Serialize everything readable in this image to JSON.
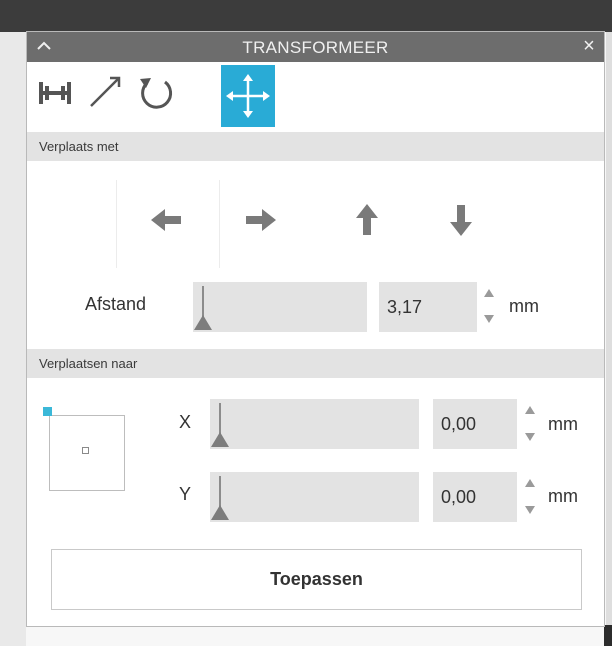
{
  "panel": {
    "title": "TRANSFORMEER",
    "close_glyph": "×"
  },
  "toolbar": {
    "tools": [
      {
        "icon": "align-icon",
        "active": false
      },
      {
        "icon": "scale-icon",
        "active": false
      },
      {
        "icon": "rotate-icon",
        "active": false
      },
      {
        "icon": "move-icon",
        "active": true
      }
    ]
  },
  "move_by": {
    "header": "Verplaats met",
    "arrows": [
      "arrow-left-icon",
      "arrow-right-icon",
      "arrow-up-icon",
      "arrow-down-icon"
    ],
    "distance_label": "Afstand",
    "distance_value": "3,17",
    "distance_unit": "mm",
    "distance_slider_fraction": 0.0
  },
  "move_to": {
    "header": "Verplaatsen naar",
    "x_label": "X",
    "x_value": "0,00",
    "x_unit": "mm",
    "y_label": "Y",
    "y_value": "0,00",
    "y_unit": "mm",
    "x_slider_fraction": 0.0,
    "y_slider_fraction": 0.0
  },
  "apply_label": "Toepassen",
  "colors": {
    "accent": "#29abd6",
    "titlebar": "#6d6d6d",
    "section_header": "#e3e3e3"
  }
}
